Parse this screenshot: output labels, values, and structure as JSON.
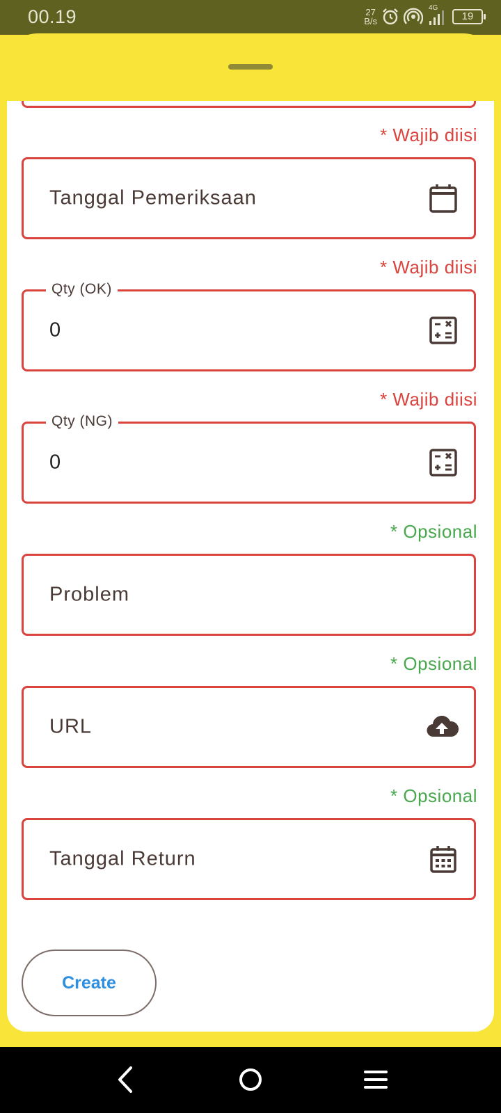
{
  "status_bar": {
    "time": "00.19",
    "net_speed_value": "27",
    "net_speed_unit": "B/s",
    "network_type": "4G",
    "battery": "19"
  },
  "form": {
    "fields": [
      {
        "label": "Tanggal Pemeriksaan",
        "note": "* Wajib diisi",
        "icon": "calendar-icon"
      },
      {
        "label": "Qty (OK)",
        "value": "0",
        "note": "* Wajib diisi",
        "icon": "calculator-icon"
      },
      {
        "label": "Qty (NG)",
        "value": "0",
        "note": "* Wajib diisi",
        "icon": "calculator-icon"
      },
      {
        "label": "Problem",
        "note": "* Opsional"
      },
      {
        "label": "URL",
        "note": "* Opsional",
        "icon": "cloud-upload-icon"
      },
      {
        "label": "Tanggal Return",
        "note": "* Opsional",
        "icon": "calendar-grid-icon"
      }
    ],
    "create_label": "Create"
  },
  "colors": {
    "status_bar": "#5F6120",
    "sheet": "#F9E43A",
    "required": "#D9443E",
    "optional": "#49A84E",
    "button_text": "#2E8FE0"
  }
}
